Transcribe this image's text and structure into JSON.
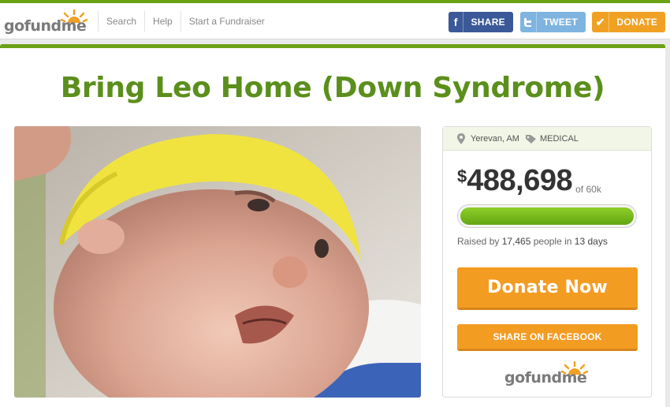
{
  "header": {
    "logo": "gofundme",
    "nav": [
      "Search",
      "Help",
      "Start a Fundraiser"
    ],
    "share_label": "SHARE",
    "tweet_label": "TWEET",
    "donate_label": "DONATE",
    "share_icon": "f",
    "donate_icon": "✔"
  },
  "campaign": {
    "title": "Bring Leo Home (Down Syndrome)",
    "location": "Yerevan, AM",
    "category": "MEDICAL",
    "currency": "$",
    "amount": "488,698",
    "goal": "of 60k",
    "progress_fraction": 1.0,
    "raised_prefix": "Raised by ",
    "raised_people": "17,465",
    "raised_mid": " people in ",
    "raised_days": "13 days",
    "donate_now": "Donate Now",
    "share_facebook": "SHARE ON FACEBOOK",
    "footer_logo": "gofundme"
  },
  "colors": {
    "brand_green": "#6aa115",
    "title_green": "#5b8f1c",
    "facebook": "#3b5998",
    "twitter": "#7fb4e0",
    "orange": "#f39c22"
  }
}
